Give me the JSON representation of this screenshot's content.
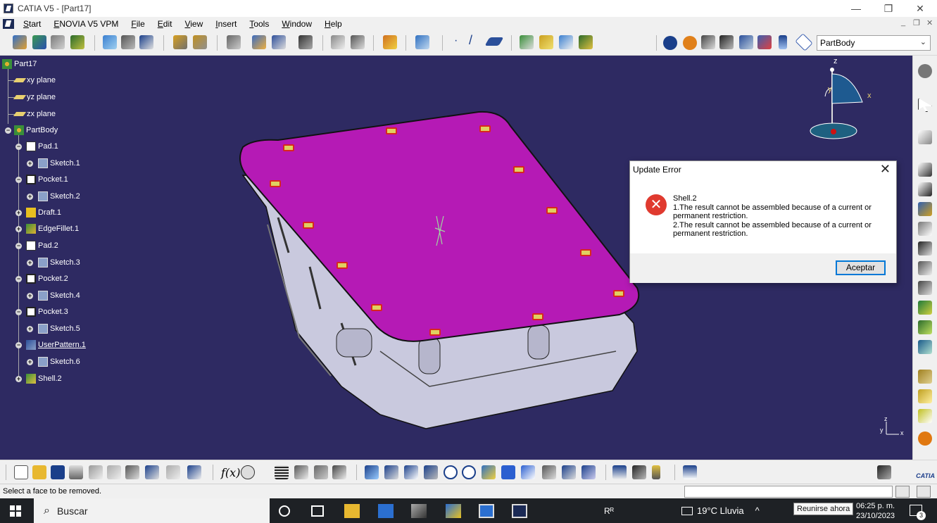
{
  "window": {
    "title": "CATIA V5 - [Part17]",
    "controls": {
      "minimize": "—",
      "restore": "❐",
      "close": "✕"
    }
  },
  "menu": {
    "items": [
      "Start",
      "ENOVIA V5 VPM",
      "File",
      "Edit",
      "View",
      "Insert",
      "Tools",
      "Window",
      "Help"
    ],
    "mdi_controls": {
      "minimize": "_",
      "restore": "❐",
      "close": "✕"
    }
  },
  "toolbar_top": {
    "workbench_body_select": "PartBody"
  },
  "tree": {
    "root": "Part17",
    "nodes": [
      {
        "label": "xy plane",
        "icon": "plane-icon"
      },
      {
        "label": "yz plane",
        "icon": "plane-icon"
      },
      {
        "label": "zx plane",
        "icon": "plane-icon"
      },
      {
        "label": "PartBody",
        "icon": "body-icon"
      },
      {
        "label": "Pad.1",
        "icon": "pad-icon"
      },
      {
        "label": "Sketch.1",
        "icon": "sketch-icon"
      },
      {
        "label": "Pocket.1",
        "icon": "pocket-icon"
      },
      {
        "label": "Sketch.2",
        "icon": "sketch-icon"
      },
      {
        "label": "Draft.1",
        "icon": "draft-icon"
      },
      {
        "label": "EdgeFillet.1",
        "icon": "fillet-icon"
      },
      {
        "label": "Pad.2",
        "icon": "pad-icon"
      },
      {
        "label": "Sketch.3",
        "icon": "sketch-icon"
      },
      {
        "label": "Pocket.2",
        "icon": "pocket-icon"
      },
      {
        "label": "Sketch.4",
        "icon": "sketch-icon"
      },
      {
        "label": "Pocket.3",
        "icon": "pocket-icon"
      },
      {
        "label": "Sketch.5",
        "icon": "sketch-icon"
      },
      {
        "label": "UserPattern.1",
        "icon": "pattern-icon"
      },
      {
        "label": "Sketch.6",
        "icon": "sketch-icon"
      },
      {
        "label": "Shell.2",
        "icon": "shell-icon"
      }
    ]
  },
  "compass": {
    "z": "z",
    "y": "y",
    "x": "x"
  },
  "axis_triad": {
    "z": "z",
    "y": "y",
    "x": "x"
  },
  "dialog": {
    "title": "Update Error",
    "close": "✕",
    "feature": "Shell.2",
    "line1": "1.The result cannot be assembled because of a current or permanent restriction.",
    "line2": "2.The result cannot be assembled because of a current or permanent restriction.",
    "ok": "Aceptar"
  },
  "statusbar": {
    "message": "Select a face to be removed."
  },
  "taskbar": {
    "search": "Buscar",
    "weather": "19°C  Lluvia",
    "tooltip": "Reunirse ahora",
    "time": "06:25 p. m.",
    "date": "23/10/2023",
    "notifications": "3"
  },
  "logo": "CATIA",
  "colors": {
    "viewport_bg": "#2e2a62",
    "top_face": "#b51ab5",
    "side_face": "#c9c9de",
    "error_icon": "#e03a2f",
    "accent_button": "#0078d7"
  }
}
